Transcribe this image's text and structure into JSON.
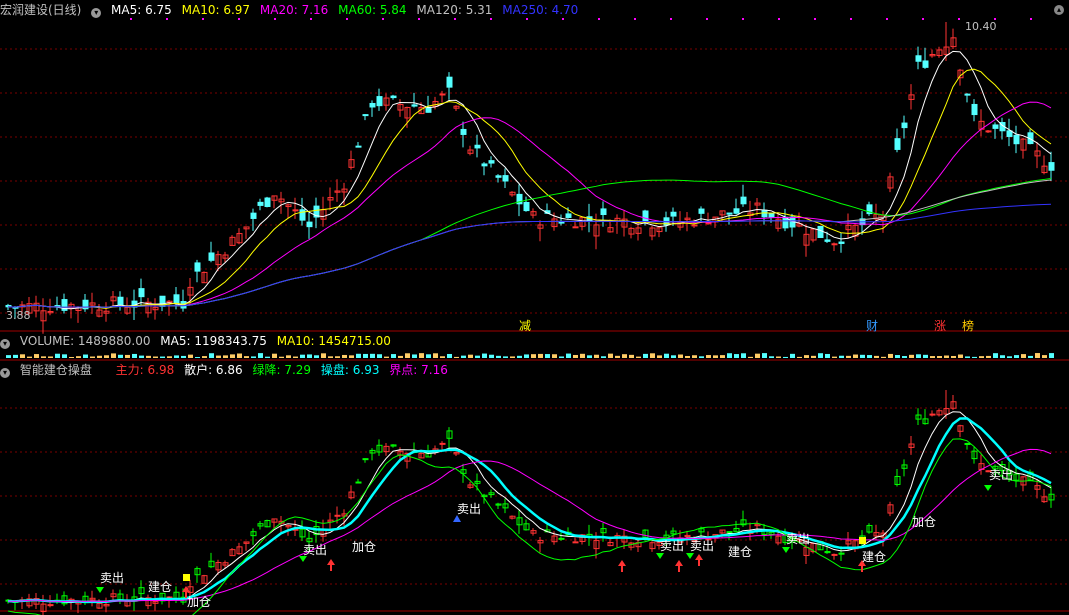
{
  "main_panel": {
    "title": "宏润建设(日线)",
    "ma": [
      {
        "label": "MA5: 6.75",
        "color": "#ffffff"
      },
      {
        "label": "MA10: 6.97",
        "color": "#ffff00"
      },
      {
        "label": "MA20: 7.16",
        "color": "#ff00ff"
      },
      {
        "label": "MA60: 5.84",
        "color": "#00ff00"
      },
      {
        "label": "MA120: 5.31",
        "color": "#c0c0c0"
      },
      {
        "label": "MA250: 4.70",
        "color": "#3333ff"
      }
    ],
    "high_label": "10.40",
    "low_label": "3.88",
    "markers": [
      {
        "text": "减",
        "color": "#ffff00"
      },
      {
        "text": "财",
        "color": "#3399ff"
      },
      {
        "text": "涨",
        "color": "#ff3333"
      },
      {
        "text": "榜",
        "color": "#ffcc00"
      }
    ]
  },
  "volume_panel": {
    "label": "VOLUME: 1489880.00",
    "ma5": "MA5: 1198343.75",
    "ma10": "MA10: 1454715.00"
  },
  "indicator_panel": {
    "title": "智能建仓操盘",
    "values": [
      {
        "label": "主力: 6.98",
        "color": "#ff3333"
      },
      {
        "label": "散户: 6.86",
        "color": "#ffffff"
      },
      {
        "label": "绿降: 7.29",
        "color": "#00ff00"
      },
      {
        "label": "操盘: 6.93",
        "color": "#00ffff"
      },
      {
        "label": "界点: 7.16",
        "color": "#ff00ff"
      }
    ],
    "signals": {
      "sell": "卖出",
      "build": "建仓",
      "add": "加仓"
    }
  },
  "colors": {
    "up": "#ff3333",
    "down": "#54ffff",
    "grid": "#7a0000",
    "border": "#a00000"
  }
}
